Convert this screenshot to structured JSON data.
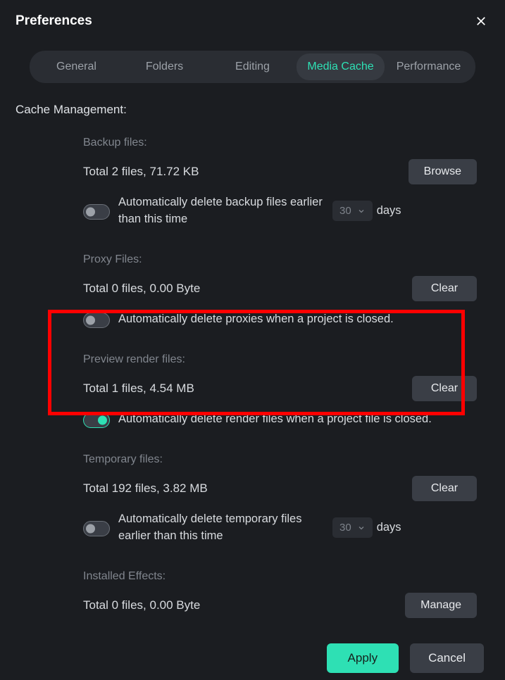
{
  "title": "Preferences",
  "tabs": [
    "General",
    "Folders",
    "Editing",
    "Media Cache",
    "Performance"
  ],
  "active_tab_index": 3,
  "section_title": "Cache Management:",
  "sections": {
    "backup": {
      "label": "Backup files:",
      "stat": "Total 2 files, 71.72 KB",
      "button": "Browse",
      "toggle_text": "Automatically delete backup files earlier than this time",
      "toggle_on": false,
      "days_value": "30",
      "days_label": "days"
    },
    "proxy": {
      "label": "Proxy Files:",
      "stat": "Total 0 files, 0.00 Byte",
      "button": "Clear",
      "toggle_text": "Automatically delete proxies when a project is closed.",
      "toggle_on": false
    },
    "preview": {
      "label": "Preview render files:",
      "stat": "Total 1 files, 4.54 MB",
      "button": "Clear",
      "toggle_text": "Automatically delete render files when a project file is closed.",
      "toggle_on": true
    },
    "temp": {
      "label": "Temporary files:",
      "stat": "Total 192 files, 3.82 MB",
      "button": "Clear",
      "toggle_text": "Automatically delete temporary files earlier than this time",
      "toggle_on": false,
      "days_value": "30",
      "days_label": "days"
    },
    "effects": {
      "label": "Installed Effects:",
      "stat": "Total 0 files, 0.00 Byte",
      "button": "Manage"
    }
  },
  "footer": {
    "apply": "Apply",
    "cancel": "Cancel"
  }
}
